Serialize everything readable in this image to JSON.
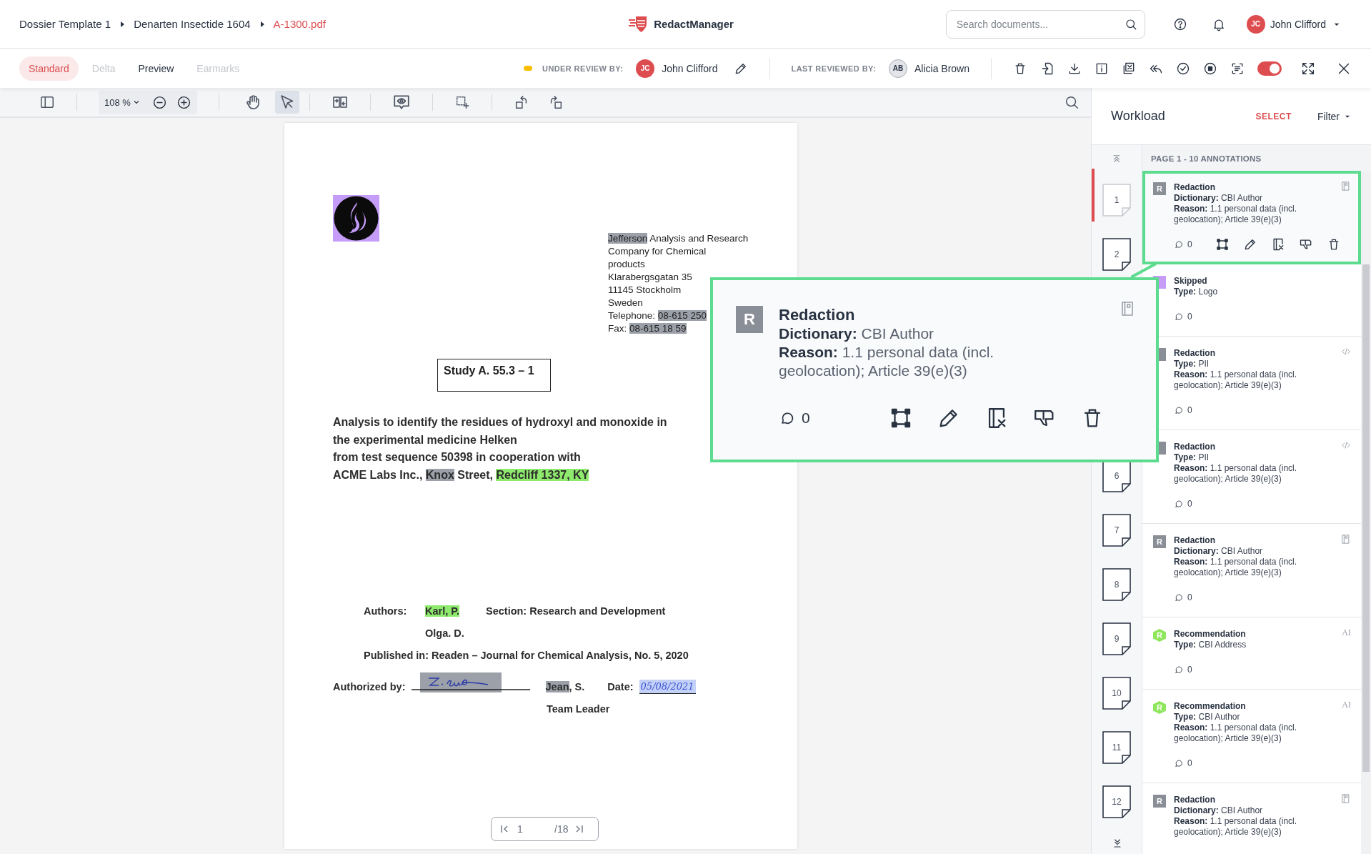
{
  "header": {
    "breadcrumbs": [
      {
        "label": "Dossier Template 1",
        "current": false
      },
      {
        "label": "Denarten Insectide 1604",
        "current": false
      },
      {
        "label": "A-1300.pdf",
        "current": true
      }
    ],
    "brand": "RedactManager",
    "search": {
      "placeholder": "Search documents..."
    },
    "user": {
      "initials": "JC",
      "name": "John Clifford"
    }
  },
  "view_bar": {
    "tabs": [
      {
        "label": "Standard",
        "selected": true,
        "disabled": false
      },
      {
        "label": "Delta",
        "selected": false,
        "disabled": true
      },
      {
        "label": "Preview",
        "selected": false,
        "disabled": false
      },
      {
        "label": "Earmarks",
        "selected": false,
        "disabled": true
      }
    ],
    "under_review": {
      "label": "UNDER REVIEW BY:",
      "initials": "JC",
      "name": "John Clifford"
    },
    "last_reviewed": {
      "label": "LAST REVIEWED BY:",
      "initials": "AB",
      "name": "Alicia Brown"
    },
    "toggle": {
      "on": true
    }
  },
  "toolbar": {
    "zoom": "108 %",
    "tools": [
      {
        "kind": "pan",
        "selected": false
      },
      {
        "kind": "select",
        "selected": true
      }
    ]
  },
  "document": {
    "address": [
      [
        {
          "text": "Jefferson",
          "kind": "redaction"
        },
        {
          "text": " Analysis and Research"
        }
      ],
      [
        {
          "text": "Company for Chemical"
        }
      ],
      [
        {
          "text": "products"
        }
      ],
      [
        {
          "text": "Klarabergsgatan 35"
        }
      ],
      [
        {
          "text": "11145 Stockholm"
        }
      ],
      [
        {
          "text": "Sweden"
        }
      ],
      [
        {
          "text": "Telephone: "
        },
        {
          "text": "08-615 250",
          "kind": "redaction"
        }
      ],
      [
        {
          "text": "Fax: "
        },
        {
          "text": "08-615 18 59",
          "kind": "redaction"
        }
      ]
    ],
    "study": "Study A. 55.3 – 1",
    "title": [
      [
        {
          "text": "Analysis to identify the residues of hydroxyl and monoxide in"
        }
      ],
      [
        {
          "text": "the experimental medicine Helken"
        }
      ],
      [
        {
          "text": "from test sequence 50398 in cooperation with"
        }
      ],
      [
        {
          "text": "ACME Labs Inc., "
        },
        {
          "text": "Knox",
          "kind": "redaction"
        },
        {
          "text": " Street, "
        },
        {
          "text": "Redcliff 1337, KY",
          "kind": "recommendation"
        }
      ]
    ],
    "authors_label": "Authors:",
    "authors": [
      [
        {
          "text": "Karl, P.",
          "kind": "recommendation"
        }
      ],
      [
        {
          "text": "Olga. D."
        }
      ]
    ],
    "section": "Section: Research and Development",
    "published": "Published in: Readen – Journal for Chemical Analysis, No. 5, 2020",
    "authorized_label": "Authorized by:",
    "signer": [
      {
        "text": "Jean",
        "kind": "redaction"
      },
      {
        "text": ", S."
      }
    ],
    "date_label": "Date:",
    "date": "05/08/2021",
    "role": "Team Leader"
  },
  "pager": {
    "page": "1",
    "total": "/18"
  },
  "workload": {
    "title": "Workload",
    "select": "SELECT",
    "filter": "Filter",
    "section": "PAGE 1 - 10 ANNOTATIONS",
    "thumbnails": [
      {
        "page": "1",
        "selected": true
      },
      {
        "page": "2",
        "selected": false
      },
      {
        "page": "6",
        "selected": false,
        "after_gap": true
      },
      {
        "page": "7",
        "selected": false
      },
      {
        "page": "8",
        "selected": false
      },
      {
        "page": "9",
        "selected": false
      },
      {
        "page": "10",
        "selected": false
      },
      {
        "page": "11",
        "selected": false
      },
      {
        "page": "12",
        "selected": false
      }
    ],
    "annotations": [
      {
        "kind": "redaction",
        "badge": "R",
        "highlighted": true,
        "indicator": {
          "kind": "dictionary"
        },
        "title": "Redaction",
        "lines": [
          "**Dictionary:** CBI Author",
          "**Reason:** 1.1 personal data (incl. geolocation); Article 39(e)(3)"
        ],
        "comments": "0"
      },
      {
        "kind": "skipped",
        "highlighted": false,
        "title": "Skipped",
        "lines": [
          "**Type:** Logo"
        ],
        "comments": "0"
      },
      {
        "kind": "redaction",
        "highlighted": false,
        "indicator": {
          "kind": "rule"
        },
        "title": "Redaction",
        "lines": [
          "**Type:** PII",
          "**Reason:** 1.1 personal data (incl. geolocation); Article 39(e)(3)"
        ],
        "comments": "0"
      },
      {
        "kind": "redaction",
        "highlighted": false,
        "indicator": {
          "kind": "rule"
        },
        "title": "Redaction",
        "lines": [
          "**Type:** PII",
          "**Reason:** 1.1 personal data (incl. geolocation); Article 39(e)(3)"
        ],
        "comments": "0"
      },
      {
        "kind": "redaction",
        "badge": "R",
        "highlighted": false,
        "indicator": {
          "kind": "dictionary"
        },
        "title": "Redaction",
        "lines": [
          "**Dictionary:** CBI Author",
          "**Reason:** 1.1 personal data (incl. geolocation); Article 39(e)(3)"
        ],
        "comments": "0"
      },
      {
        "kind": "recommendation",
        "badge": "R",
        "highlighted": false,
        "tag": "AI",
        "title": "Recommendation",
        "lines": [
          "**Type:** CBI Address"
        ],
        "comments": "0"
      },
      {
        "kind": "recommendation",
        "badge": "R",
        "highlighted": false,
        "tag": "AI",
        "title": "Recommendation",
        "lines": [
          "**Type:** CBI Author",
          "**Reason:** 1.1 personal data (incl. geolocation); Article 39(e)(3)"
        ],
        "comments": "0"
      },
      {
        "kind": "redaction",
        "badge": "R",
        "highlighted": false,
        "indicator": {
          "kind": "dictionary"
        },
        "title": "Redaction",
        "lines": [
          "**Dictionary:** CBI Author",
          "**Reason:** 1.1 personal data (incl. geolocation); Article 39(e)(3)"
        ]
      }
    ]
  },
  "callout": {
    "badge": "R",
    "title": "Redaction",
    "lines": [
      "**Dictionary:** CBI Author",
      "**Reason:** 1.1 personal data (incl. geolocation); Article 39(e)(3)"
    ],
    "comments": "0"
  }
}
